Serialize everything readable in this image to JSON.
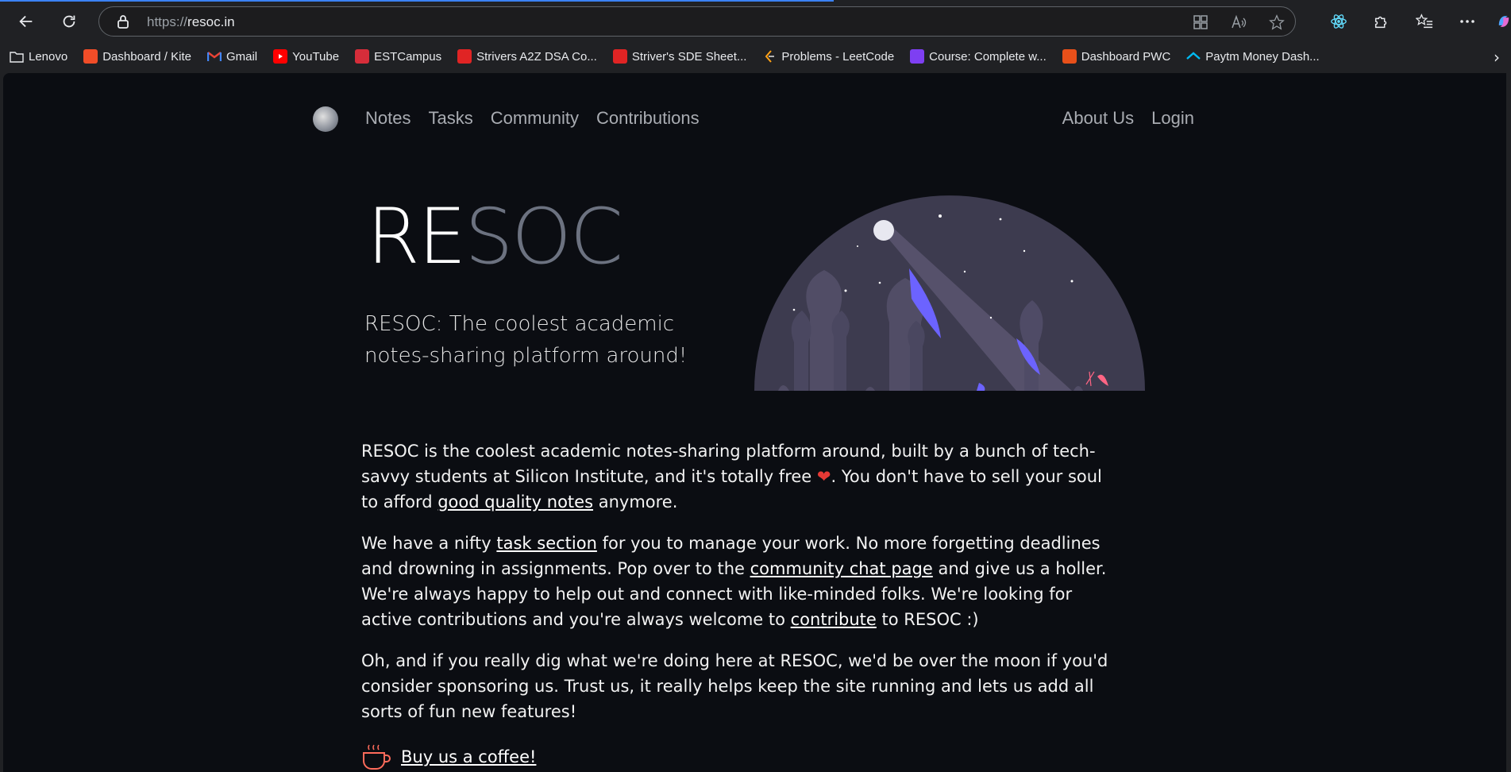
{
  "browser": {
    "url_prefix": "https://",
    "url_host": "resoc.in",
    "bookmarks": [
      {
        "label": "Lenovo",
        "color": "transparent",
        "icon": "folder-icon"
      },
      {
        "label": "Dashboard / Kite",
        "color": "#f04d28",
        "icon": "kite-icon"
      },
      {
        "label": "Gmail",
        "color": "transparent",
        "icon": "gmail-icon"
      },
      {
        "label": "YouTube",
        "color": "#ff0000",
        "icon": "youtube-icon"
      },
      {
        "label": "ESTCampus",
        "color": "#d62d3a",
        "icon": "estcampus-icon"
      },
      {
        "label": "Strivers A2Z DSA Co...",
        "color": "#e02424",
        "icon": "tuf-icon"
      },
      {
        "label": "Striver's SDE Sheet...",
        "color": "#e02424",
        "icon": "tuf-icon"
      },
      {
        "label": "Problems - LeetCode",
        "color": "transparent",
        "icon": "leetcode-icon"
      },
      {
        "label": "Course: Complete w...",
        "color": "#7e3ff2",
        "icon": "course-icon"
      },
      {
        "label": "Dashboard PWC",
        "color": "#e8501a",
        "icon": "pwc-icon"
      },
      {
        "label": "Paytm Money Dash...",
        "color": "transparent",
        "icon": "paytm-icon"
      }
    ]
  },
  "site": {
    "nav_left": [
      "Notes",
      "Tasks",
      "Community",
      "Contributions"
    ],
    "nav_right": [
      "About Us",
      "Login"
    ],
    "hero_title_a": "RE",
    "hero_title_b": "SOC",
    "hero_subtitle": "RESOC: The coolest academic notes-sharing platform around!",
    "p1_a": "RESOC is the coolest academic notes-sharing platform around, built by a bunch of tech-savvy students at Silicon Institute, and it's totally free ",
    "p1_b": ". You don't have to sell your soul to afford ",
    "p1_link": "good quality notes",
    "p1_c": " anymore.",
    "p2_a": "We have a nifty ",
    "p2_link1": "task section",
    "p2_b": " for you to manage your work. No more forgetting deadlines and drowning in assignments. Pop over to the ",
    "p2_link2": "community chat page",
    "p2_c": " and give us a holler. We're always happy to help out and connect with like-minded folks. We're looking for active contributions and you're always welcome to ",
    "p2_link3": "contribute",
    "p2_d": " to RESOC :)",
    "p3": "Oh, and if you really dig what we're doing here at RESOC, we'd be over the moon if you'd consider sponsoring us. Trust us, it really helps keep the site running and lets us add all sorts of fun new features!",
    "coffee_label": "Buy us a coffee!",
    "colors": {
      "accent": "#6c63ff",
      "background": "#0b0d12"
    }
  }
}
